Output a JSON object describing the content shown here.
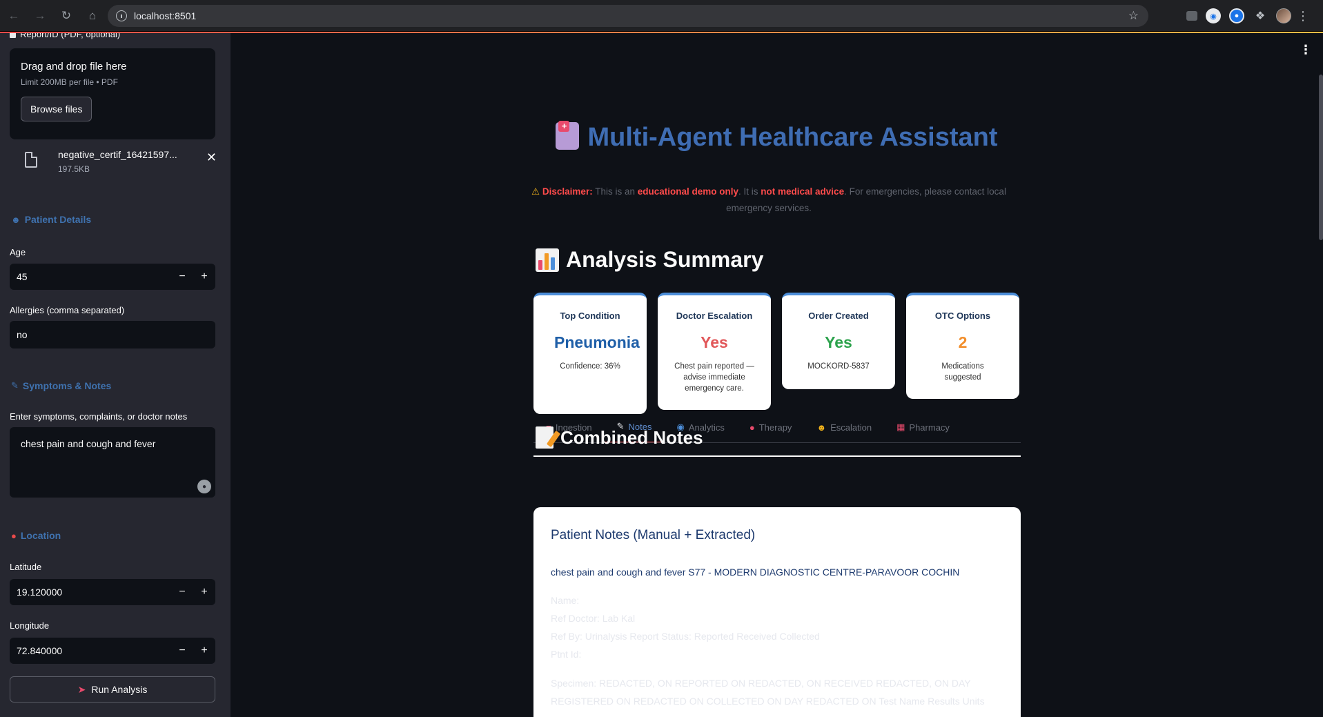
{
  "browser": {
    "url": "localhost:8501"
  },
  "sidebar": {
    "upload": {
      "label": "Report/ID (PDF, optional)",
      "drop_title": "Drag and drop file here",
      "limit": "Limit 200MB per file • PDF",
      "browse_label": "Browse files",
      "file_name": "negative_certif_16421597...",
      "file_size": "197.5KB"
    },
    "patient_section": "Patient Details",
    "age_label": "Age",
    "age_value": "45",
    "allergies_label": "Allergies (comma separated)",
    "allergies_value": "no",
    "symptoms_section": "Symptoms & Notes",
    "symptoms_label": "Enter symptoms, complaints, or doctor notes",
    "symptoms_value": "chest pain and cough and fever",
    "location_section": "Location",
    "latitude_label": "Latitude",
    "latitude_value": "19.120000",
    "longitude_label": "Longitude",
    "longitude_value": "72.840000",
    "run_label": "Run Analysis"
  },
  "main": {
    "title": "Multi-Agent Healthcare Assistant",
    "disclaimer": {
      "prefix": "Disclaimer:",
      "t1": " This is an ",
      "b1": "educational demo only",
      "t2": ". It is ",
      "b2": "not medical advice",
      "t3": ". For emergencies, please contact local emergency services."
    },
    "summary_heading": "Analysis Summary",
    "cards": [
      {
        "label": "Top Condition",
        "value": "Pneumonia",
        "sub": "Confidence: 36%",
        "color": "#1f5fa8"
      },
      {
        "label": "Doctor Escalation",
        "value": "Yes",
        "sub": "Chest pain reported — advise immediate emergency care.",
        "color": "#e15759"
      },
      {
        "label": "Order Created",
        "value": "Yes",
        "sub": "MOCKORD-5837",
        "color": "#2ca24c"
      },
      {
        "label": "OTC Options",
        "value": "2",
        "sub": "Medications suggested",
        "color": "#f28e2b"
      }
    ],
    "tabs": [
      "Ingestion",
      "Notes",
      "Analytics",
      "Therapy",
      "Escalation",
      "Pharmacy"
    ],
    "active_tab": "Notes",
    "notes_heading": "Combined Notes",
    "notes_title": "Patient Notes (Manual + Extracted)",
    "notes_body": "chest pain and cough and fever S77 - MODERN DIAGNOSTIC CENTRE-PARAVOOR COCHIN",
    "notes_faded": [
      "Name:",
      "Ref Doctor: Lab Kal",
      "Ref By: Urinalysis Report Status: Reported Received Collected",
      "Ptnt Id:",
      "Specimen: REDACTED, ON REPORTED ON REDACTED, ON RECEIVED REDACTED, ON DAY",
      "REGISTERED ON REDACTED ON COLLECTED ON DAY REDACTED ON Test Name Results Units"
    ]
  }
}
